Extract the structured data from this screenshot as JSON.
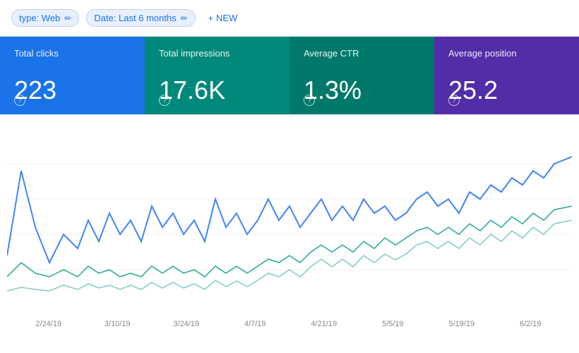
{
  "topbar": {
    "type_filter_label": "type: Web",
    "date_filter_label": "Date: Last 6 months",
    "new_button_label": "+ NEW"
  },
  "metrics": [
    {
      "id": "clicks",
      "label": "Total clicks",
      "value": "223",
      "color": "#1a73e8"
    },
    {
      "id": "impressions",
      "label": "Total impressions",
      "value": "17.6K",
      "color": "#00897b"
    },
    {
      "id": "ctr",
      "label": "Average CTR",
      "value": "1.3%",
      "color": "#00796b"
    },
    {
      "id": "position",
      "label": "Average position",
      "value": "25.2",
      "color": "#512da8"
    }
  ],
  "chart": {
    "x_labels": [
      "2/24/19",
      "3/10/19",
      "3/24/19",
      "4/7/19",
      "4/21/19",
      "5/5/19",
      "5/19/19",
      "6/2/19"
    ]
  }
}
